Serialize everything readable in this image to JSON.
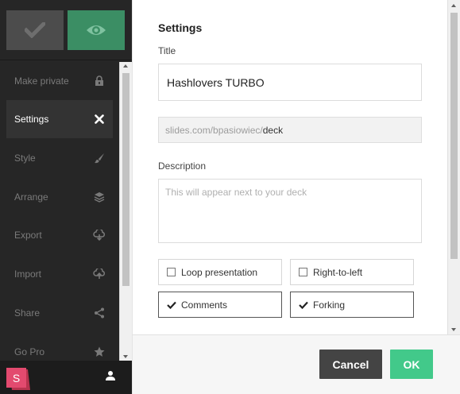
{
  "sidebar": {
    "top_buttons": [
      {
        "name": "save",
        "icon": "checkmark-icon"
      },
      {
        "name": "preview",
        "icon": "eye-icon"
      }
    ],
    "items": [
      {
        "label": "Make private",
        "icon": "lock-icon"
      },
      {
        "label": "Settings",
        "icon": "close-icon",
        "active": true
      },
      {
        "label": "Style",
        "icon": "brush-icon"
      },
      {
        "label": "Arrange",
        "icon": "layers-icon"
      },
      {
        "label": "Export",
        "icon": "cloud-download-icon"
      },
      {
        "label": "Import",
        "icon": "cloud-upload-icon"
      },
      {
        "label": "Share",
        "icon": "share-icon"
      },
      {
        "label": "Go Pro",
        "icon": "star-icon"
      }
    ],
    "logo_letter": "S",
    "user_icon": "user-icon"
  },
  "settings": {
    "heading": "Settings",
    "title_label": "Title",
    "title_value": "Hashlovers TURBO",
    "slug_prefix": "slides.com/bpasiowiec/",
    "slug_name": "deck",
    "description_label": "Description",
    "description_placeholder": "This will appear next to your deck",
    "options": [
      {
        "label": "Loop presentation",
        "checked": false
      },
      {
        "label": "Right-to-left",
        "checked": false
      },
      {
        "label": "Comments",
        "checked": true
      },
      {
        "label": "Forking",
        "checked": true
      }
    ]
  },
  "footer": {
    "cancel_label": "Cancel",
    "ok_label": "OK"
  },
  "colors": {
    "sidebar_bg": "#262626",
    "preview_green": "#3b8e64",
    "ok_green": "#42c98a",
    "cancel_dark": "#444444",
    "logo_pink": "#e34a6f"
  }
}
